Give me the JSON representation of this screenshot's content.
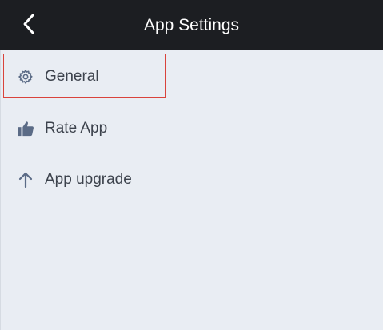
{
  "header": {
    "title": "App Settings",
    "back_icon": "chevron-left-icon"
  },
  "settings": {
    "items": [
      {
        "label": "General",
        "icon": "gear-icon"
      },
      {
        "label": "Rate App",
        "icon": "thumbs-up-icon"
      },
      {
        "label": "App upgrade",
        "icon": "arrow-up-icon"
      }
    ]
  },
  "colors": {
    "header_bg": "#1c1e22",
    "header_text": "#ffffff",
    "content_bg": "#e9edf3",
    "item_text": "#3c424c",
    "icon_color": "#5b6b86",
    "highlight_border": "#d9433b"
  }
}
